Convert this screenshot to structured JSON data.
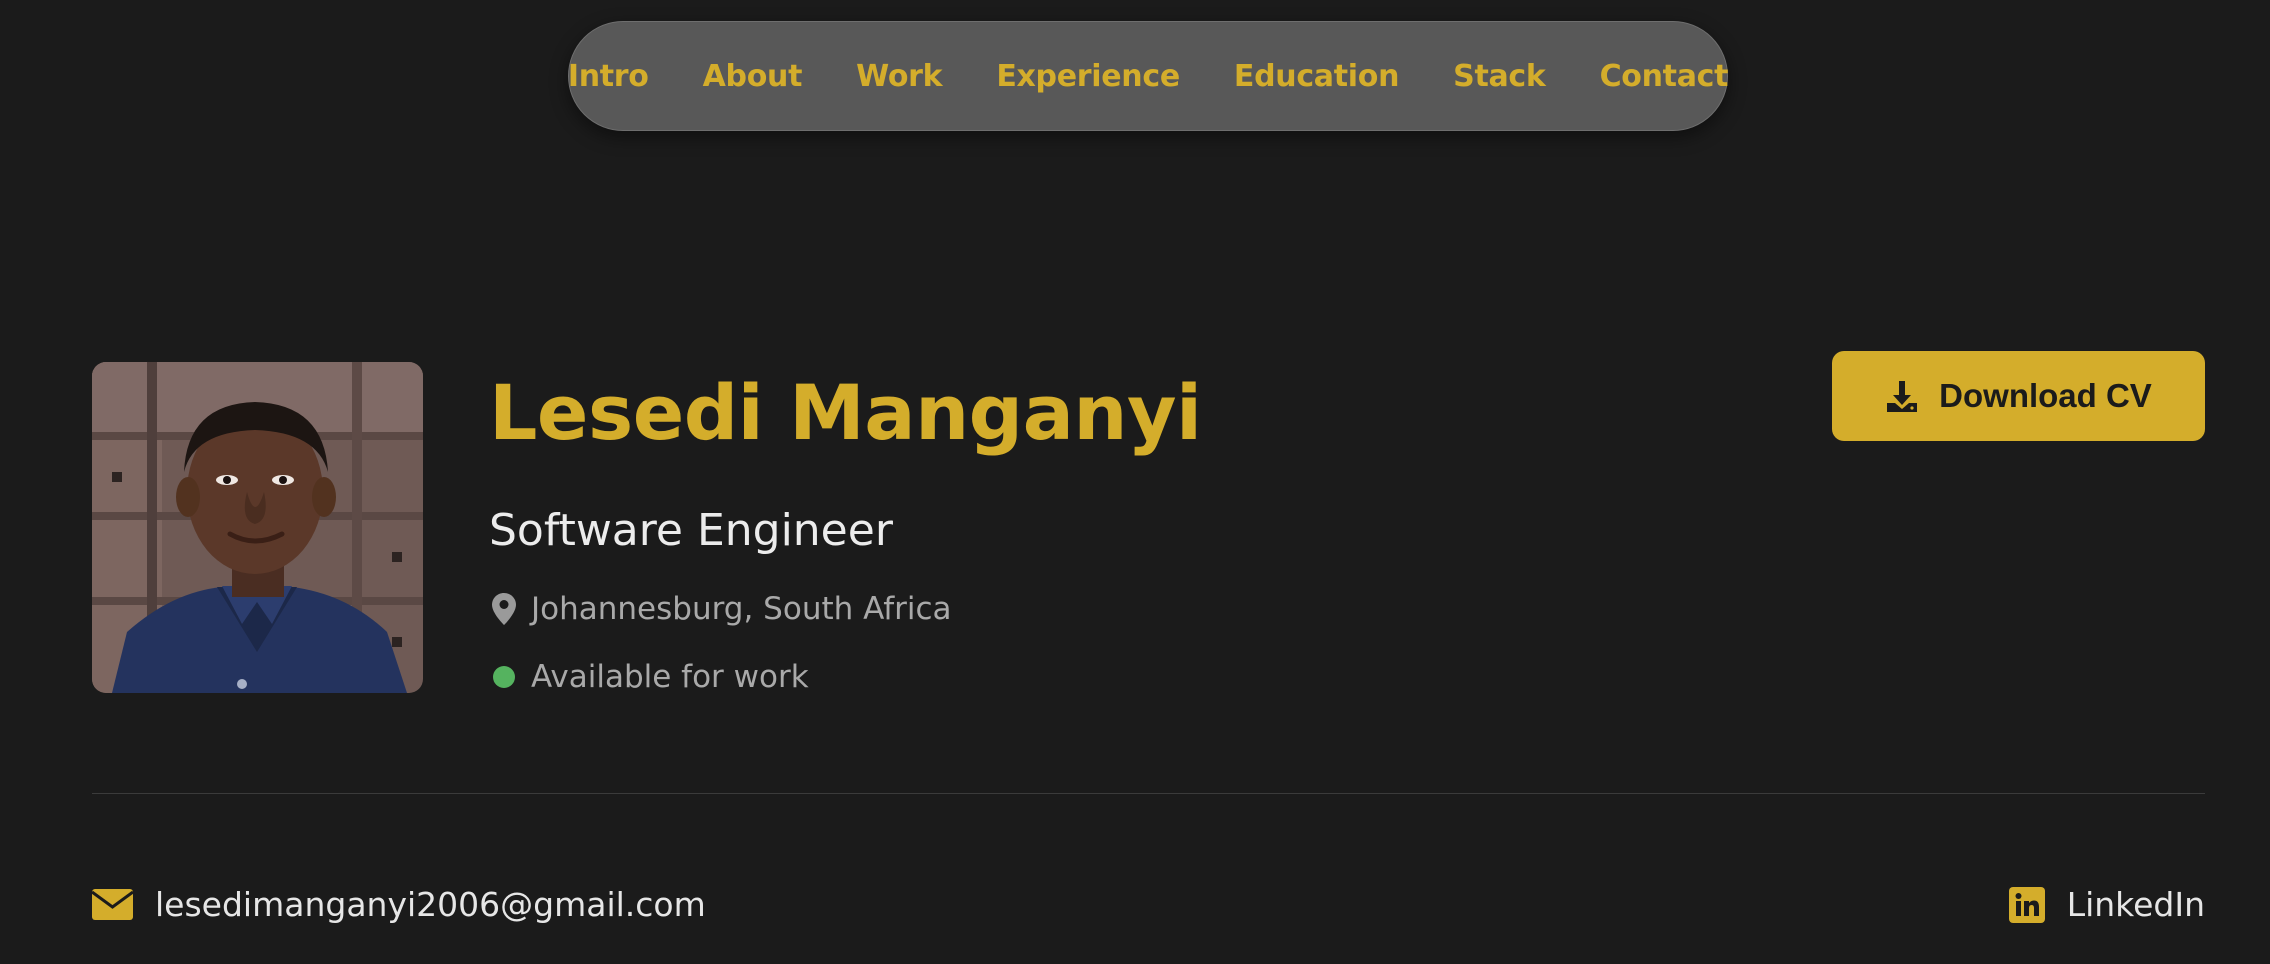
{
  "nav": {
    "items": [
      {
        "label": "Intro"
      },
      {
        "label": "About"
      },
      {
        "label": "Work"
      },
      {
        "label": "Experience"
      },
      {
        "label": "Education"
      },
      {
        "label": "Stack"
      },
      {
        "label": "Contact"
      }
    ]
  },
  "profile": {
    "name": "Lesedi Manganyi",
    "role": "Software Engineer",
    "location": "Johannesburg, South Africa",
    "availability": "Available for work",
    "location_icon": "map-pin-icon",
    "status_color": "#55b35f"
  },
  "actions": {
    "download_label": "Download CV",
    "download_icon": "download-icon"
  },
  "contacts": {
    "email": "lesedimanganyi2006@gmail.com",
    "email_icon": "envelope-icon",
    "linkedin": "LinkedIn",
    "linkedin_icon": "linkedin-icon"
  },
  "colors": {
    "background": "#1b1b1b",
    "accent": "#d4ad2b",
    "nav_bg": "#585858",
    "muted_text": "#a9a9a9"
  }
}
